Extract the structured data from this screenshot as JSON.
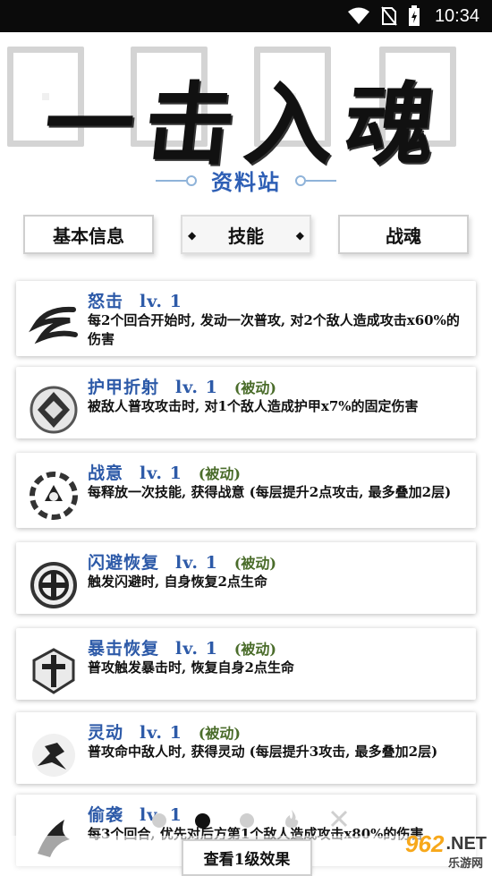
{
  "status_bar": {
    "time": "10:34"
  },
  "banner": {
    "title": "一击入魂",
    "subtitle": "资料站"
  },
  "tabs": [
    {
      "label": "基本信息",
      "active": false
    },
    {
      "label": "技能",
      "active": true
    },
    {
      "label": "战魂",
      "active": false
    }
  ],
  "skills": [
    {
      "name": "怒击",
      "level": "lv. 1",
      "passive": "",
      "desc": "每2个回合开始时, 发动一次普攻, 对2个敌人造成攻击x60%的伤害",
      "icon": "slash-icon"
    },
    {
      "name": "护甲折射",
      "level": "lv. 1",
      "passive": "(被动)",
      "desc": "被敌人普攻攻击时, 对1个敌人造成护甲x7%的固定伤害",
      "icon": "armor-icon"
    },
    {
      "name": "战意",
      "level": "lv. 1",
      "passive": "(被动)",
      "desc": "每释放一次技能, 获得战意 (每层提升2点攻击, 最多叠加2层)",
      "icon": "battle-will-icon"
    },
    {
      "name": "闪避恢复",
      "level": "lv. 1",
      "passive": "(被动)",
      "desc": "触发闪避时, 自身恢复2点生命",
      "icon": "dodge-heal-icon"
    },
    {
      "name": "暴击恢复",
      "level": "lv. 1",
      "passive": "(被动)",
      "desc": "普攻触发暴击时, 恢复自身2点生命",
      "icon": "crit-heal-icon"
    },
    {
      "name": "灵动",
      "level": "lv. 1",
      "passive": "(被动)",
      "desc": "普攻命中敌人时, 获得灵动 (每层提升3攻击, 最多叠加2层)",
      "icon": "agility-icon"
    },
    {
      "name": "偷袭",
      "level": "lv. 1",
      "passive": "",
      "desc": "每3个回合, 优先对后方第1个敌人造成攻击x80%的伤害",
      "icon": "sneak-attack-icon"
    }
  ],
  "pager": {
    "count": 3,
    "active": 1
  },
  "bottom_button": {
    "label": "查看1级效果"
  },
  "watermark": {
    "num": "962",
    "net": ".NET",
    "sub": "乐游网"
  }
}
